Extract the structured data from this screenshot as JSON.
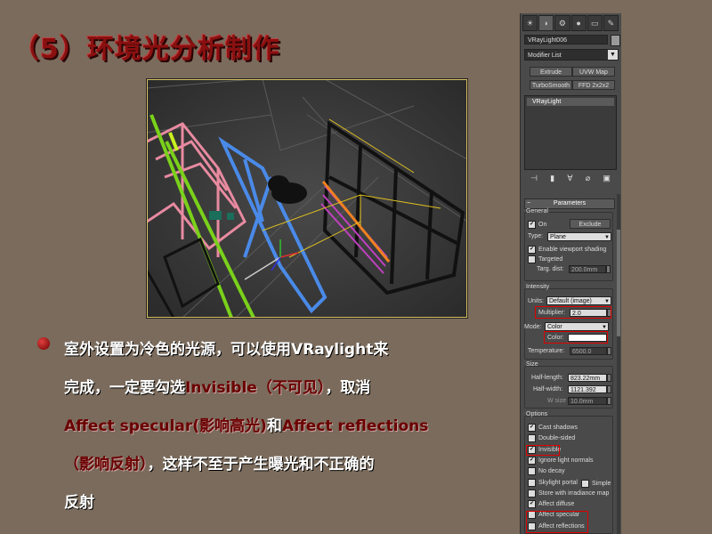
{
  "slide": {
    "title": "（5）环境光分析制作",
    "bullet_lines": [
      [
        {
          "t": "室外设置为冷色的光源，可以使用VRaylight来",
          "c": "white"
        }
      ],
      [
        {
          "t": "完成，一定要勾选",
          "c": "white"
        },
        {
          "t": "Invisible（不可见）",
          "c": "red"
        },
        {
          "t": "，取消",
          "c": "white"
        }
      ],
      [
        {
          "t": "Affect specular(影响高光)",
          "c": "red"
        },
        {
          "t": "和",
          "c": "white"
        },
        {
          "t": "Affect reflections",
          "c": "red"
        }
      ],
      [
        {
          "t": "（影响反射）",
          "c": "red"
        },
        {
          "t": "，这样不至于产生曝光和不正确的",
          "c": "white"
        }
      ],
      [
        {
          "t": "反射",
          "c": "white"
        }
      ]
    ]
  },
  "panel": {
    "object_name": "VRayLight006",
    "modifier_list": "Modifier List",
    "buttons": {
      "extrude": "Extrude",
      "uvw_map": "UVW Map",
      "turbosmooth": "TurboSmooth",
      "ffd": "FFD 2x2x2"
    },
    "stack_item": "VRayLight",
    "rollout_title": "Parameters",
    "general": {
      "label": "General",
      "on_label": "On",
      "exclude_label": "Exclude",
      "type_label": "Type:",
      "type_value": "Plane",
      "viewport_shading": "Enable viewport shading",
      "targeted": "Targeted",
      "targ_dist_label": "Targ. dist:",
      "targ_dist_value": "200.0mm"
    },
    "intensity": {
      "label": "Intensity",
      "units_label": "Units:",
      "units_value": "Default (image)",
      "multiplier_label": "Multiplier:",
      "multiplier_value": "2.0",
      "mode_label": "Mode:",
      "mode_value": "Color",
      "color_label": "Color:",
      "temperature_label": "Temperature:",
      "temperature_value": "6500.0"
    },
    "size": {
      "label": "Size",
      "half_length_label": "Half-length:",
      "half_length_value": "823.22mm",
      "half_width_label": "Half-width:",
      "half_width_value": "1121.392",
      "w_size_label": "W size",
      "w_size_value": "10.0mm"
    },
    "options": {
      "label": "Options",
      "items": [
        {
          "label": "Cast shadows",
          "checked": "✔"
        },
        {
          "label": "Double-sided",
          "checked": ""
        },
        {
          "label": "Invisible",
          "checked": "✔"
        },
        {
          "label": "Ignore light normals",
          "checked": "✔"
        },
        {
          "label": "No decay",
          "checked": ""
        },
        {
          "label": "Skylight portal",
          "checked": ""
        },
        {
          "label": "Store with irradiance map",
          "checked": ""
        },
        {
          "label": "Affect diffuse",
          "checked": "✔"
        },
        {
          "label": "Affect specular",
          "checked": ""
        },
        {
          "label": "Affect reflections",
          "checked": ""
        }
      ],
      "simple_label": "Simple"
    },
    "highlight_color": "#e00000"
  }
}
